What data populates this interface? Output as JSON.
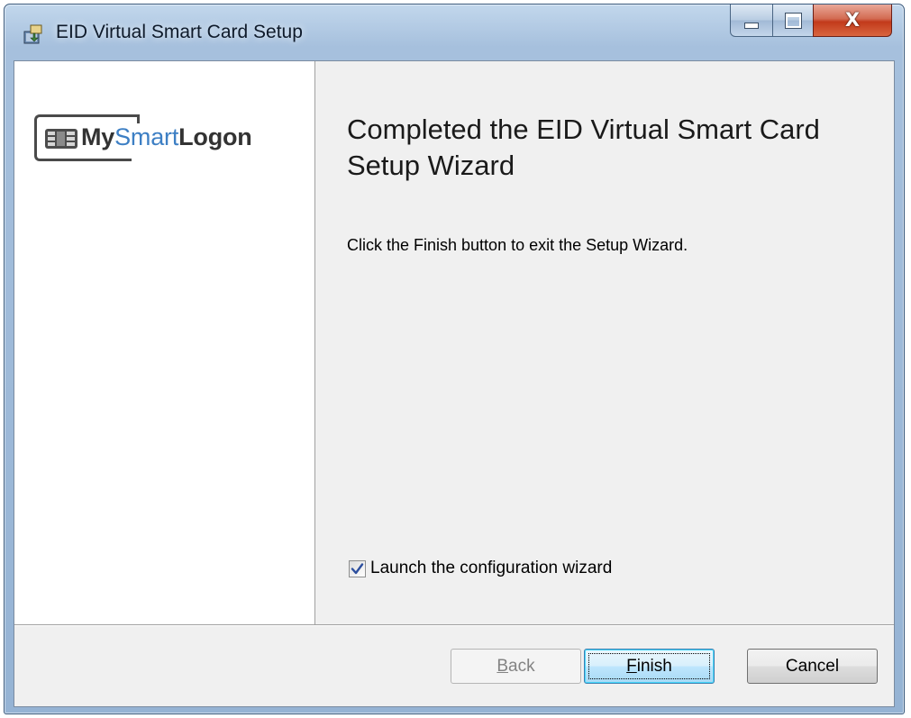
{
  "window": {
    "title": "EID Virtual Smart Card Setup",
    "icons": {
      "app": "setup-installer-icon",
      "minimize": "minimize-icon",
      "maximize": "maximize-icon",
      "close": "close-icon"
    },
    "close_glyph": "X"
  },
  "logo": {
    "part1": "My",
    "part2": "Smart",
    "part3": "Logon",
    "brand_color": "#3d7fc4",
    "text_color": "#333333"
  },
  "main": {
    "heading": "Completed the EID Virtual Smart Card Setup Wizard",
    "message": "Click the Finish button to exit the Setup Wizard.",
    "checkbox": {
      "label": "Launch the configuration wizard",
      "checked": true
    }
  },
  "buttons": {
    "back": {
      "mnemonic": "B",
      "rest": "ack",
      "enabled": false
    },
    "finish": {
      "mnemonic": "F",
      "rest": "inish",
      "default": true
    },
    "cancel": {
      "label": "Cancel"
    }
  }
}
